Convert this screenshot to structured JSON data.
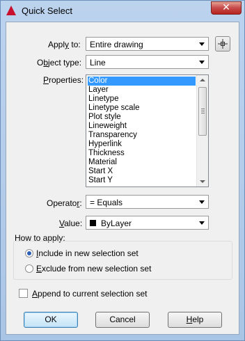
{
  "window": {
    "title": "Quick Select",
    "close_glyph": "✕"
  },
  "apply_to": {
    "label_pre": "Appl",
    "label_key": "y",
    "label_post": " to:",
    "value": "Entire drawing"
  },
  "object_type": {
    "label_pre": "O",
    "label_key": "b",
    "label_post": "ject type:",
    "value": "Line"
  },
  "properties": {
    "label_pre": "",
    "label_key": "P",
    "label_post": "roperties:",
    "items": [
      "Color",
      "Layer",
      "Linetype",
      "Linetype scale",
      "Plot style",
      "Lineweight",
      "Transparency",
      "Hyperlink",
      "Thickness",
      "Material",
      "Start X",
      "Start Y"
    ],
    "selected_index": 0
  },
  "operator": {
    "label_pre": "Operato",
    "label_key": "r",
    "label_post": ":",
    "value": "= Equals"
  },
  "value": {
    "label_pre": "",
    "label_key": "V",
    "label_post": "alue:",
    "value": "ByLayer",
    "swatch_color": "#000000"
  },
  "how_to_apply": {
    "title": "How to apply:",
    "include_pre": "",
    "include_key": "I",
    "include_post": "nclude in new selection set",
    "exclude_pre": "",
    "exclude_key": "E",
    "exclude_post": "xclude from new selection set",
    "selected": "include"
  },
  "append": {
    "label_pre": "",
    "label_key": "A",
    "label_post": "ppend to current selection set",
    "checked": false
  },
  "buttons": {
    "ok": "OK",
    "cancel": "Cancel",
    "help_pre": "",
    "help_key": "H",
    "help_post": "elp"
  },
  "icons": {
    "app": "autocad-icon",
    "pick": "crosshair-icon"
  }
}
